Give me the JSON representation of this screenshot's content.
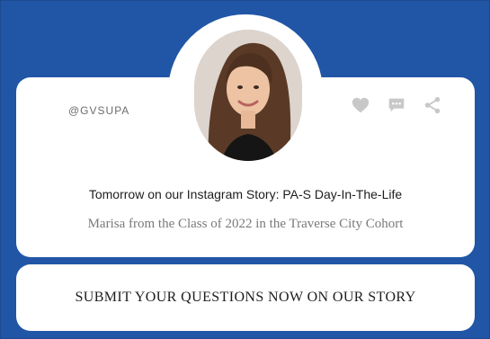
{
  "card": {
    "handle": "@GVSUPA",
    "headline": "Tomorrow on our Instagram Story: PA-S Day-In-The-Life",
    "subtitle": "Marisa from the Class of 2022 in the Traverse City Cohort",
    "cta": "SUBMIT YOUR QUESTIONS NOW ON OUR STORY"
  },
  "icons": [
    "heart-icon",
    "comment-icon",
    "share-icon"
  ],
  "colors": {
    "background": "#2156a6",
    "card": "#ffffff",
    "icon": "#c8c8c8"
  }
}
